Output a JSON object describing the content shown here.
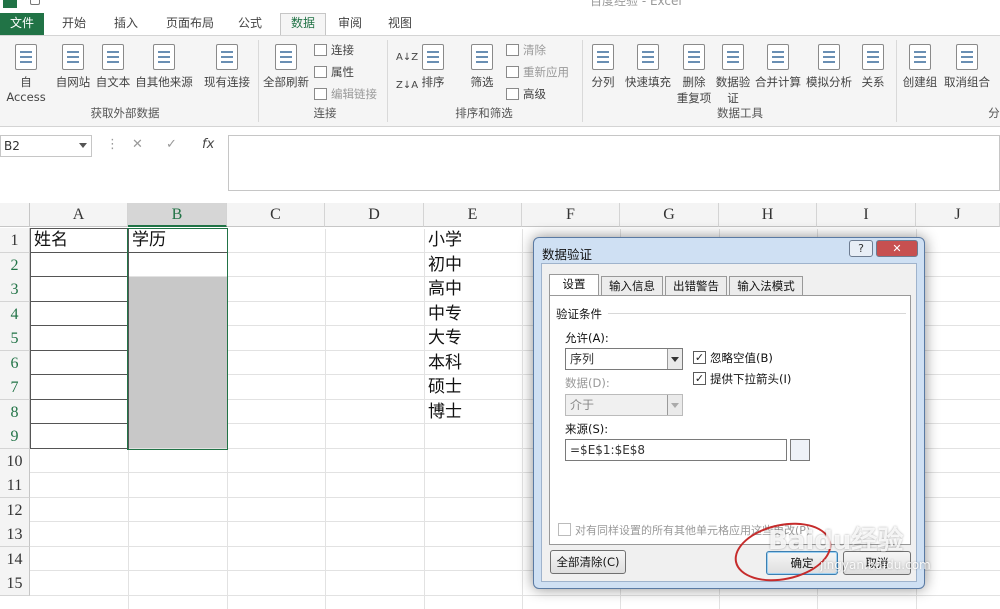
{
  "window": {
    "title": "百度经验 - Excel"
  },
  "tabs": [
    "文件",
    "开始",
    "插入",
    "页面布局",
    "公式",
    "数据",
    "审阅",
    "视图"
  ],
  "active_tab": "数据",
  "ribbon": {
    "get_external": {
      "access": "自 Access",
      "web": "自网站",
      "text": "自文本",
      "other": "自其他来源",
      "existing": "现有连接",
      "group": "获取外部数据"
    },
    "connections": {
      "refresh": "全部刷新",
      "connect": "连接",
      "props": "属性",
      "edit_links": "编辑链接",
      "group": "连接"
    },
    "sort_filter": {
      "az": "A↓Z",
      "za": "Z↓A",
      "sort": "排序",
      "filter": "筛选",
      "clear": "清除",
      "reapply": "重新应用",
      "advanced": "高级",
      "group": "排序和筛选"
    },
    "data_tools": {
      "split": "分列",
      "flash_fill": "快速填充",
      "remove_dup_1": "删除",
      "remove_dup_2": "重复项",
      "validate_1": "数据验",
      "validate_2": "证",
      "consolidate": "合并计算",
      "whatif": "模拟分析",
      "relations": "关系",
      "group": "数据工具"
    },
    "outline": {
      "group_btn": "创建组",
      "ungroup_btn": "取消组合",
      "group_part": "分"
    }
  },
  "formula_bar": {
    "name_box": "B2",
    "cancel": "✕",
    "enter": "✓",
    "fx": "fx",
    "formula": ""
  },
  "columns": [
    "A",
    "B",
    "C",
    "D",
    "E",
    "F",
    "G",
    "H",
    "I",
    "J"
  ],
  "rows": [
    "1",
    "2",
    "3",
    "4",
    "5",
    "6",
    "7",
    "8",
    "9",
    "10",
    "11",
    "12",
    "13",
    "14",
    "15"
  ],
  "cells": {
    "A1": "姓名",
    "B1": "学历",
    "E1": "小学",
    "E2": "初中",
    "E3": "高中",
    "E4": "中专",
    "E5": "大专",
    "E6": "本科",
    "E7": "硕士",
    "E8": "博士"
  },
  "dialog": {
    "title": "数据验证",
    "help": "?",
    "close": "✕",
    "tabs": [
      "设置",
      "输入信息",
      "出错警告",
      "输入法模式"
    ],
    "section": "验证条件",
    "allow_label": "允许(A):",
    "allow_value": "序列",
    "ignore_blank": "忽略空值(B)",
    "in_cell_dropdown": "提供下拉箭头(I)",
    "data_label": "数据(D):",
    "data_value": "介于",
    "source_label": "来源(S):",
    "source_value": "=$E$1:$E$8",
    "apply_all": "对有同样设置的所有其他单元格应用这些更改(P)",
    "clear_all": "全部清除(C)",
    "ok": "确定",
    "cancel": "取消",
    "checked_mark": "✓"
  },
  "watermark": {
    "line1": "Baidu经验",
    "line2": "jingyan.baidu.com"
  },
  "colors": {
    "excel_green": "#217346",
    "annotation_red": "#c62c2c",
    "range_gray": "#c8c8c8"
  }
}
